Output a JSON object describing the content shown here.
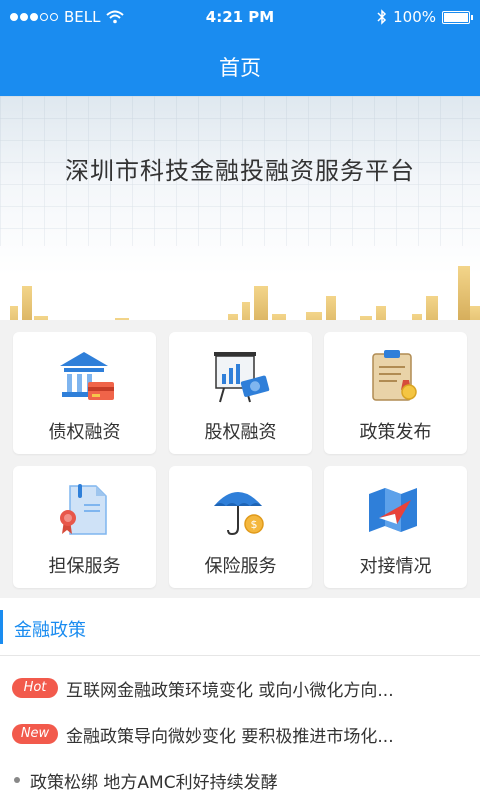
{
  "status_bar": {
    "carrier": "BELL",
    "time": "4:21 PM",
    "battery": "100%",
    "signal_icon": "signal-dots-icon",
    "wifi_icon": "wifi-icon",
    "bluetooth_icon": "bluetooth-icon",
    "battery_icon": "battery-icon"
  },
  "nav": {
    "title": "首页"
  },
  "banner": {
    "title": "深圳市科技金融投融资服务平台",
    "page_count": 2,
    "active_page": 0
  },
  "services": [
    {
      "label": "债权融资",
      "icon": "bank-card-icon"
    },
    {
      "label": "股权融资",
      "icon": "presentation-chart-icon"
    },
    {
      "label": "政策发布",
      "icon": "clipboard-medal-icon"
    },
    {
      "label": "担保服务",
      "icon": "document-ribbon-icon"
    },
    {
      "label": "保险服务",
      "icon": "umbrella-coin-icon"
    },
    {
      "label": "对接情况",
      "icon": "map-arrow-icon"
    }
  ],
  "news": {
    "section_title": "金融政策",
    "items": [
      {
        "badge": "Hot",
        "text": "互联网金融政策环境变化 或向小微化方向..."
      },
      {
        "badge": "New",
        "text": "金融政策导向微妙变化 要积极推进市场化..."
      },
      {
        "badge": "",
        "text": "政策松绑 地方AMC利好持续发酵"
      }
    ]
  },
  "colors": {
    "primary": "#1a8cf0",
    "badge": "#f25a4c"
  }
}
